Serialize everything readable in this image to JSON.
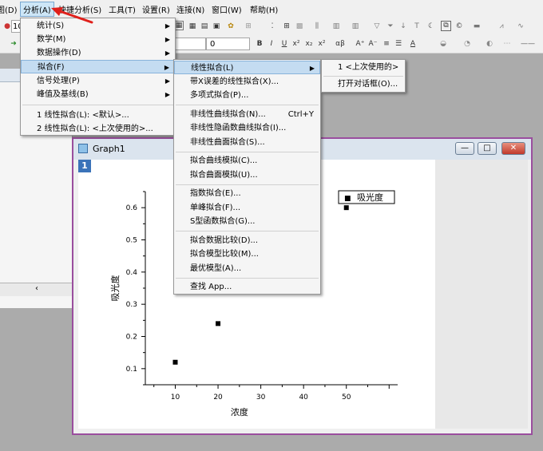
{
  "menubar": {
    "items": [
      {
        "label": "图(D)"
      },
      {
        "label": "分析(A)"
      },
      {
        "label": "快捷分析(S)"
      },
      {
        "label": "工具(T)"
      },
      {
        "label": "设置(R)"
      },
      {
        "label": "连接(N)"
      },
      {
        "label": "窗口(W)"
      },
      {
        "label": "帮助(H)"
      }
    ]
  },
  "toolbar": {
    "font_size_combo": "0",
    "zoom_combo": "10"
  },
  "analysis_menu": {
    "items": [
      {
        "label": "统计(S)",
        "submenu": true
      },
      {
        "label": "数学(M)",
        "submenu": true
      },
      {
        "label": "数据操作(D)",
        "submenu": true
      },
      {
        "label": "拟合(F)",
        "submenu": true
      },
      {
        "label": "信号处理(P)",
        "submenu": true
      },
      {
        "label": "峰值及基线(B)",
        "submenu": true
      },
      {
        "label": "1 线性拟合(L): <默认>..."
      },
      {
        "label": "2 线性拟合(L): <上次使用的>..."
      }
    ]
  },
  "fit_menu": {
    "items": [
      {
        "label": "线性拟合(L)",
        "submenu": true
      },
      {
        "label": "带X误差的线性拟合(X)..."
      },
      {
        "label": "多项式拟合(P)..."
      },
      {
        "label": "非线性曲线拟合(N)...",
        "shortcut": "Ctrl+Y"
      },
      {
        "label": "非线性隐函数曲线拟合(I)..."
      },
      {
        "label": "非线性曲面拟合(S)..."
      },
      {
        "label": "拟合曲线模拟(C)..."
      },
      {
        "label": "拟合曲面模拟(U)..."
      },
      {
        "label": "指数拟合(E)..."
      },
      {
        "label": "单峰拟合(F)..."
      },
      {
        "label": "S型函数拟合(G)..."
      },
      {
        "label": "拟合数据比较(D)..."
      },
      {
        "label": "拟合模型比较(M)..."
      },
      {
        "label": "最优模型(A)..."
      },
      {
        "label": "查找 App..."
      }
    ]
  },
  "linear_fit_menu": {
    "items": [
      {
        "label": "1 <上次使用的>"
      },
      {
        "label": "打开对话框(O)..."
      }
    ]
  },
  "graph_window": {
    "title": "Graph1",
    "layer": "1",
    "min_symbol": "—",
    "max_symbol": "□",
    "close_symbol": "✕"
  },
  "chart_data": {
    "type": "scatter",
    "x": [
      10,
      20,
      50
    ],
    "y": [
      0.12,
      0.24,
      0.6
    ],
    "series": [
      {
        "name": "吸光度",
        "x": [
          10,
          20,
          50
        ],
        "y": [
          0.12,
          0.24,
          0.6
        ]
      }
    ],
    "xlabel": "浓度",
    "ylabel": "吸光度",
    "xticks": [
      "10",
      "20",
      "30",
      "40",
      "50"
    ],
    "yticks": [
      "0.1",
      "0.2",
      "0.3",
      "0.4",
      "0.5",
      "0.6"
    ],
    "xlim": [
      3,
      62
    ],
    "ylim": [
      0.05,
      0.65
    ],
    "legend_position": "top-right",
    "legend_symbol": "■",
    "grid": false
  }
}
